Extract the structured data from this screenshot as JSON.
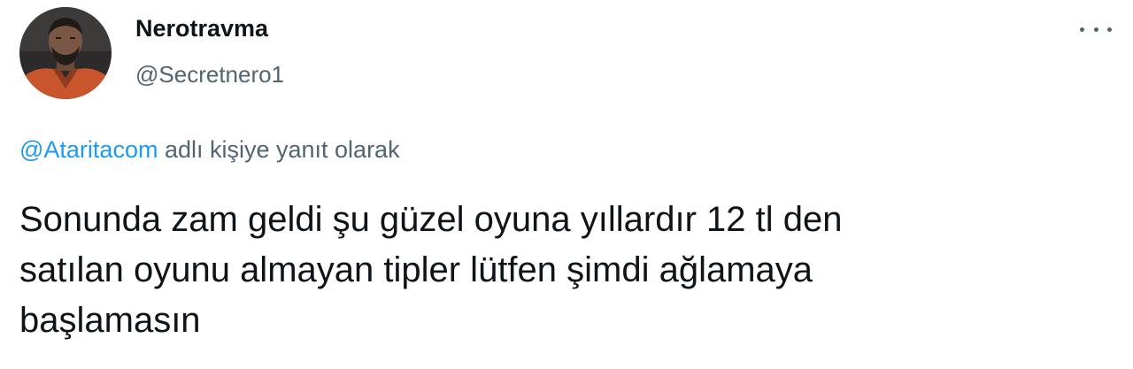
{
  "author": {
    "display_name": "Nerotravma",
    "handle": "@Secretnero1",
    "avatar_icon": "user-avatar"
  },
  "menu": {
    "icon": "more-horizontal-icon"
  },
  "reply_context": {
    "mention": "@Ataritacom",
    "suffix": " adlı kişiye yanıt olarak"
  },
  "tweet": {
    "line1": "Sonunda zam geldi şu güzel oyuna yıllardır 12 tl den",
    "line2": "satılan oyunu almayan tipler lütfen şimdi ağlamaya",
    "line3": "başlamasın"
  },
  "colors": {
    "link": "#1d9bf0",
    "secondary_text": "#536471",
    "primary_text": "#0f1419"
  }
}
